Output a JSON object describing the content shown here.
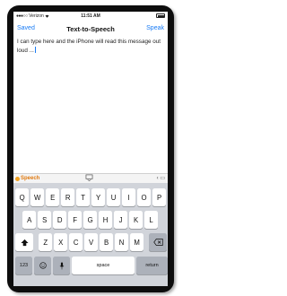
{
  "status_bar": {
    "carrier": "Verizon",
    "time": "11:51 AM"
  },
  "nav": {
    "left_label": "Saved",
    "title": "Text-to-Speech",
    "right_label": "Speak"
  },
  "editor": {
    "text": "I can type here and the iPhone will read this message out loud ..."
  },
  "accessory": {
    "app_name": "Speech"
  },
  "keyboard": {
    "row1": [
      "Q",
      "W",
      "E",
      "R",
      "T",
      "Y",
      "U",
      "I",
      "O",
      "P"
    ],
    "row2": [
      "A",
      "S",
      "D",
      "F",
      "G",
      "H",
      "J",
      "K",
      "L"
    ],
    "row3": [
      "Z",
      "X",
      "C",
      "V",
      "B",
      "N",
      "M"
    ],
    "numbers_label": "123",
    "space_label": "space",
    "return_label": "return"
  },
  "colors": {
    "accent": "#1a7cf5",
    "keyboard_bg": "#d1d4da",
    "logo": "#e07a10"
  }
}
